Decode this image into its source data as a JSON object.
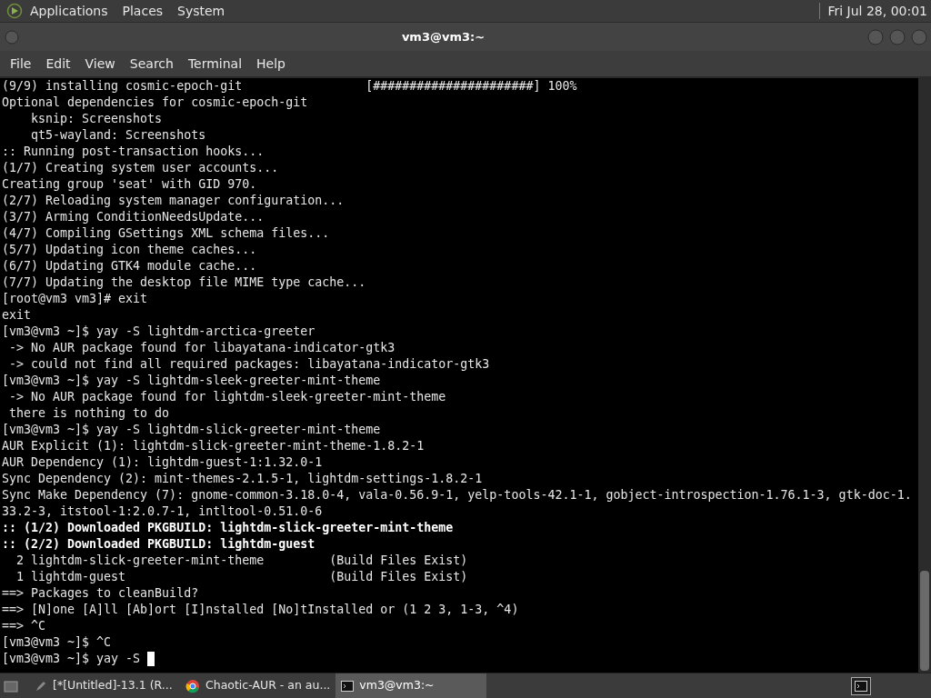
{
  "top_panel": {
    "menus": [
      "Applications",
      "Places",
      "System"
    ],
    "clock": "Fri Jul 28, 00:01"
  },
  "window": {
    "title": "vm3@vm3:~"
  },
  "menu_bar": [
    "File",
    "Edit",
    "View",
    "Search",
    "Terminal",
    "Help"
  ],
  "terminal": {
    "lines": [
      {
        "kind": "normal",
        "text": "(9/9) installing cosmic-epoch-git                 [######################] 100%"
      },
      {
        "kind": "normal",
        "text": "Optional dependencies for cosmic-epoch-git"
      },
      {
        "kind": "normal",
        "text": "    ksnip: Screenshots"
      },
      {
        "kind": "normal",
        "text": "    qt5-wayland: Screenshots"
      },
      {
        "kind": "normal",
        "text": ":: Running post-transaction hooks..."
      },
      {
        "kind": "normal",
        "text": "(1/7) Creating system user accounts..."
      },
      {
        "kind": "normal",
        "text": "Creating group 'seat' with GID 970."
      },
      {
        "kind": "normal",
        "text": "(2/7) Reloading system manager configuration..."
      },
      {
        "kind": "normal",
        "text": "(3/7) Arming ConditionNeedsUpdate..."
      },
      {
        "kind": "normal",
        "text": "(4/7) Compiling GSettings XML schema files..."
      },
      {
        "kind": "normal",
        "text": "(5/7) Updating icon theme caches..."
      },
      {
        "kind": "normal",
        "text": "(6/7) Updating GTK4 module cache..."
      },
      {
        "kind": "normal",
        "text": "(7/7) Updating the desktop file MIME type cache..."
      },
      {
        "kind": "normal",
        "text": "[root@vm3 vm3]# exit"
      },
      {
        "kind": "normal",
        "text": "exit"
      },
      {
        "kind": "normal",
        "text": "[vm3@vm3 ~]$ yay -S lightdm-arctica-greeter"
      },
      {
        "kind": "normal",
        "text": " -> No AUR package found for libayatana-indicator-gtk3"
      },
      {
        "kind": "normal",
        "text": " -> could not find all required packages: libayatana-indicator-gtk3"
      },
      {
        "kind": "normal",
        "text": "[vm3@vm3 ~]$ yay -S lightdm-sleek-greeter-mint-theme"
      },
      {
        "kind": "normal",
        "text": " -> No AUR package found for lightdm-sleek-greeter-mint-theme"
      },
      {
        "kind": "normal",
        "text": " there is nothing to do"
      },
      {
        "kind": "normal",
        "text": "[vm3@vm3 ~]$ yay -S lightdm-slick-greeter-mint-theme"
      },
      {
        "kind": "normal",
        "text": "AUR Explicit (1): lightdm-slick-greeter-mint-theme-1.8.2-1"
      },
      {
        "kind": "normal",
        "text": "AUR Dependency (1): lightdm-guest-1:1.32.0-1"
      },
      {
        "kind": "normal",
        "text": "Sync Dependency (2): mint-themes-2.1.5-1, lightdm-settings-1.8.2-1"
      },
      {
        "kind": "normal",
        "text": "Sync Make Dependency (7): gnome-common-3.18.0-4, vala-0.56.9-1, yelp-tools-42.1-1, gobject-introspection-1.76.1-3, gtk-doc-1."
      },
      {
        "kind": "normal",
        "text": "33.2-3, itstool-1:2.0.7-1, intltool-0.51.0-6"
      },
      {
        "kind": "bold",
        "text": ":: (1/2) Downloaded PKGBUILD: lightdm-slick-greeter-mint-theme"
      },
      {
        "kind": "bold",
        "text": ":: (2/2) Downloaded PKGBUILD: lightdm-guest"
      },
      {
        "kind": "normal",
        "text": "  2 lightdm-slick-greeter-mint-theme         (Build Files Exist)"
      },
      {
        "kind": "normal",
        "text": "  1 lightdm-guest                            (Build Files Exist)"
      },
      {
        "kind": "normal",
        "text": "==> Packages to cleanBuild?"
      },
      {
        "kind": "normal",
        "text": "==> [N]one [A]ll [Ab]ort [I]nstalled [No]tInstalled or (1 2 3, 1-3, ^4)"
      },
      {
        "kind": "normal",
        "text": "==> ^C"
      },
      {
        "kind": "normal",
        "text": "[vm3@vm3 ~]$ ^C"
      },
      {
        "kind": "cursor",
        "text": "[vm3@vm3 ~]$ yay -S "
      }
    ]
  },
  "taskbar": {
    "tasks": [
      {
        "label": "[*[Untitled]-13.1 (R...",
        "selected": false
      },
      {
        "label": "Chaotic-AUR - an au...",
        "selected": false
      },
      {
        "label": "vm3@vm3:~",
        "selected": true
      }
    ]
  }
}
